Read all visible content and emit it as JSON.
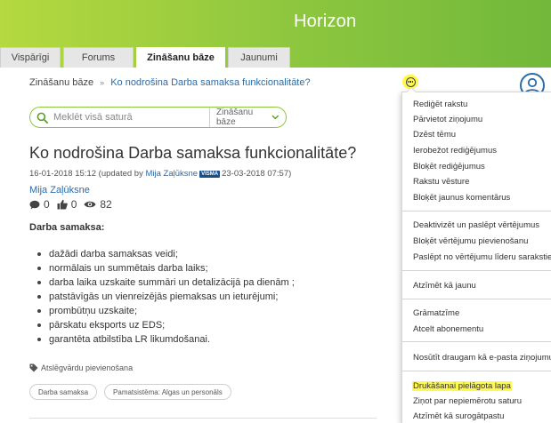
{
  "header": {
    "brand": "Horizon"
  },
  "tabs": [
    {
      "label": "Vispārīgi",
      "active": false
    },
    {
      "label": "Forums",
      "active": false
    },
    {
      "label": "Zināšanu bāze",
      "active": true
    },
    {
      "label": "Jaunumi",
      "active": false
    }
  ],
  "breadcrumb": {
    "home": "Zināšanu bāze",
    "separator": "»",
    "current": "Ko nodrošina Darba samaksa funkcionalitāte?"
  },
  "search": {
    "placeholder": "Meklēt visā saturā",
    "scope": "Zināšanu bāze"
  },
  "article": {
    "title": "Ko nodrošina Darba samaksa funkcionalitāte?",
    "meta": {
      "created": "16-01-2018 15:12",
      "updated_prefix": "(updated by",
      "updated_by": "Mija Zaļūksne",
      "badge": "VISMA",
      "updated_at": "23-03-2018 07:57)"
    },
    "author": "Mija Zaļūksne",
    "stats": {
      "comments": "0",
      "likes": "0",
      "views": "82"
    },
    "section_heading": "Darba samaksa:",
    "bullets": [
      "dažādi darba samaksas veidi;",
      "normālais un summētais darba laiks;",
      "darba laika uzskaite summāri un detalizācijā pa dienām ;",
      "patstāvīgās un vienreizējās piemaksas un ieturējumi;",
      "prombūtņu uzskaite;",
      "pārskatu eksports uz EDS;",
      "garantēta atbilstība LR likumdošanai."
    ],
    "tag_label": "Atslēgvārdu pievienošana",
    "tags": [
      "Darba samaksa",
      "Pamatsistēma: Algas un personāls"
    ]
  },
  "menu": {
    "groups": [
      [
        "Rediģēt rakstu",
        "Pārvietot ziņojumu",
        "Dzēst tēmu",
        "Ierobežot rediģējumus",
        "Bloķēt rediģējumus",
        "Rakstu vēsture",
        "Bloķēt jaunus komentārus"
      ],
      [
        "Deaktivizēt un paslēpt vērtējumus",
        "Bloķēt vērtējumu pievienošanu",
        "Paslēpt no vērtējumu līderu sarakstiem"
      ],
      [
        "Atzīmēt kā jaunu"
      ],
      [
        "Grāmatzīme",
        "Atcelt abonementu"
      ],
      [
        "Nosūtīt draugam kā e-pasta ziņojumu"
      ],
      [
        "Drukāšanai pielāgota lapa",
        "Ziņot par nepiemērotu saturu",
        "Atzīmēt kā surogātpastu"
      ]
    ],
    "highlighted": "Drukāšanai pielāgota lapa",
    "highlight_color": "#fff84d"
  },
  "colors": {
    "brand_green": "#8cc63f",
    "link_blue": "#2a6ca8"
  }
}
